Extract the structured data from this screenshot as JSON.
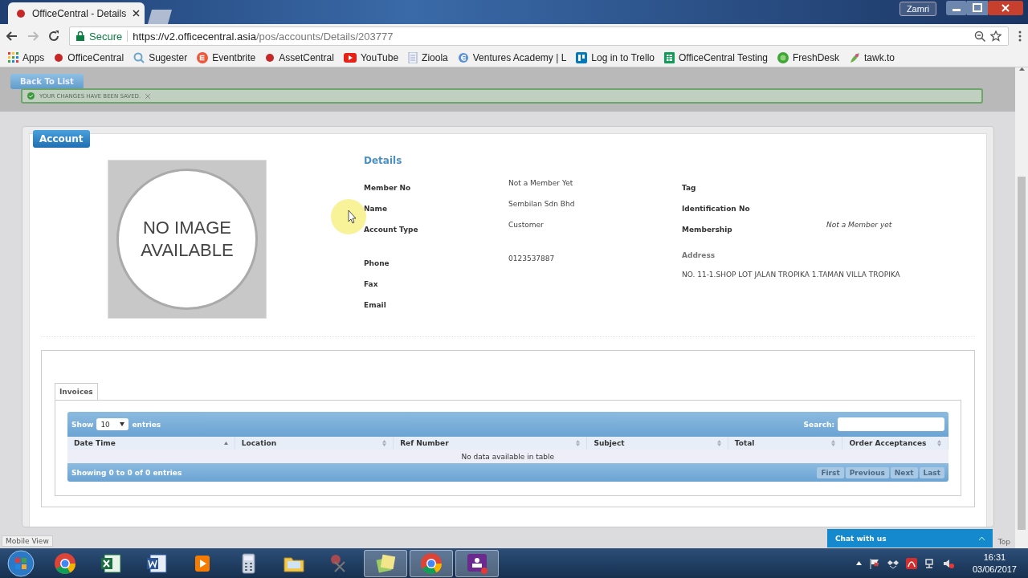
{
  "browser": {
    "tabs": [
      {
        "title": "OfficeCentral - Details",
        "selected": true
      }
    ],
    "profile": "Zamri",
    "address": {
      "secure_label": "Secure",
      "host": "https://v2.officecentral.asia",
      "path": "/pos/accounts/Details/203777"
    },
    "bookmarks": [
      {
        "label": "Apps",
        "kind": "grid"
      },
      {
        "label": "OfficeCentral",
        "kind": "dot"
      },
      {
        "label": "Sugester",
        "kind": "sugester"
      },
      {
        "label": "Eventbrite",
        "kind": "eventbrite"
      },
      {
        "label": "AssetCentral",
        "kind": "dot"
      },
      {
        "label": "YouTube",
        "kind": "youtube"
      },
      {
        "label": "Zioola",
        "kind": "doc"
      },
      {
        "label": "Ventures Academy | L",
        "kind": "ie"
      },
      {
        "label": "Log in to Trello",
        "kind": "trello"
      },
      {
        "label": "OfficeCentral Testing",
        "kind": "sheet"
      },
      {
        "label": "FreshDesk",
        "kind": "freshdesk"
      },
      {
        "label": "tawk.to",
        "kind": "tawk"
      }
    ]
  },
  "page": {
    "back_button": "Back To List",
    "notice": "YOUR CHANGES HAVE BEEN SAVED.",
    "panel_title": "Account",
    "image_placeholder": "NO IMAGE AVAILABLE",
    "details_heading": "Details",
    "left_groups": [
      [
        {
          "label": "Member No",
          "value": "Not a Member Yet"
        },
        {
          "label": "Name",
          "value": "Sembilan Sdn Bhd"
        },
        {
          "label": "Account Type",
          "value": "Customer"
        }
      ],
      [
        {
          "label": "Phone",
          "value": "0123537887"
        },
        {
          "label": "Fax"
        },
        {
          "label": "Email"
        }
      ]
    ],
    "right_groups": [
      [
        {
          "label": "Tag",
          "kind": "inline"
        },
        {
          "label": "Identification No",
          "kind": "inline"
        },
        {
          "label": "Membership",
          "value": "Not a Member yet",
          "kind": "inline"
        }
      ],
      [
        {
          "label": "Address",
          "value": "NO. 11-1.SHOP LOT JALAN TROPIKA 1.TAMAN VILLA TROPIKA",
          "kind": "stacked"
        }
      ]
    ],
    "invoices": {
      "tabs": [
        {
          "label": "Invoices",
          "selected": true
        }
      ],
      "show_label": "Show",
      "page_size": "10",
      "entries_label": "entries",
      "search_label": "Search:",
      "columns": [
        {
          "label": "Date Time",
          "sorted": true
        },
        {
          "label": "Location",
          "sorted": false
        },
        {
          "label": "Ref Number",
          "sorted": false
        },
        {
          "label": "Subject",
          "sorted": false
        },
        {
          "label": "Total",
          "sorted": false
        },
        {
          "label": "Order Acceptances",
          "sorted": false
        }
      ],
      "empty_message": "No data available in table",
      "info": "Showing 0 to 0 of 0 entries",
      "pager": [
        {
          "label": "First",
          "disabled": true
        },
        {
          "label": "Previous",
          "disabled": true
        },
        {
          "label": "Next",
          "disabled": true
        },
        {
          "label": "Last",
          "disabled": true
        }
      ]
    },
    "mobile_view": "Mobile View",
    "top_link": "Top",
    "chat": "Chat with us"
  },
  "taskbar": {
    "apps": [
      {
        "kind": "chrome",
        "active": false
      },
      {
        "kind": "excel",
        "active": false
      },
      {
        "kind": "word",
        "active": false
      },
      {
        "kind": "media",
        "active": false
      },
      {
        "kind": "calculator",
        "active": false
      },
      {
        "kind": "folder",
        "active": false
      },
      {
        "kind": "scissors",
        "active": false
      },
      {
        "kind": "notes",
        "active": true
      },
      {
        "kind": "chrome",
        "active": true
      },
      {
        "kind": "video",
        "active": true
      }
    ],
    "time": "16:31",
    "date": "03/06/2017"
  }
}
